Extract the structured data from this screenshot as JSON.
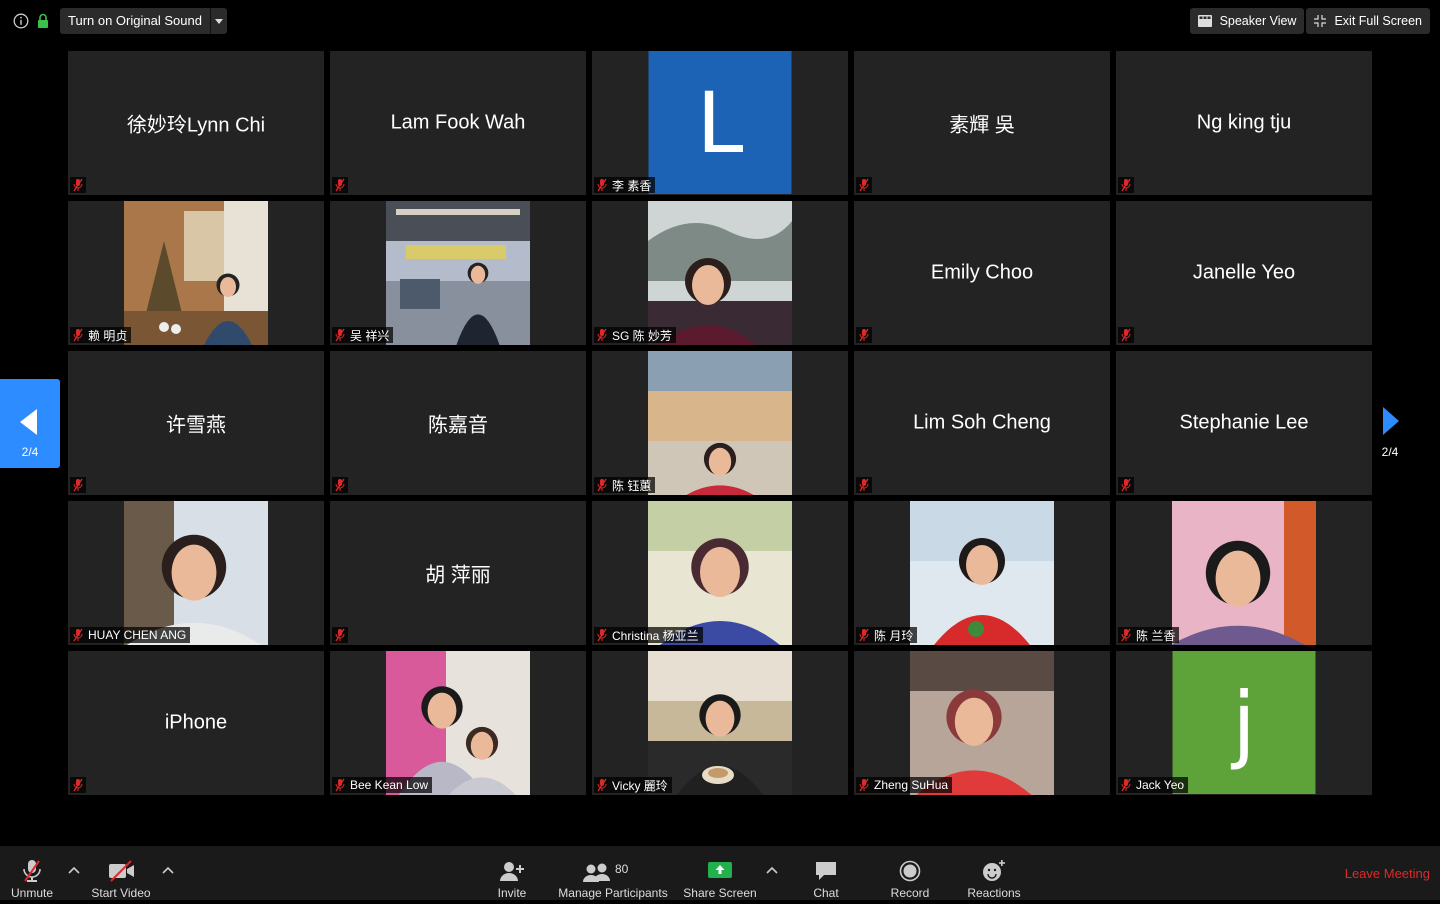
{
  "topbar": {
    "original_sound": "Turn on Original Sound",
    "speaker_view": "Speaker View",
    "exit_full_screen": "Exit Full Screen"
  },
  "pager": {
    "left_page": "2/4",
    "right_page": "2/4"
  },
  "participants": [
    {
      "name": "徐妙玲Lynn Chi",
      "kind": "text"
    },
    {
      "name": "Lam Fook Wah",
      "kind": "text"
    },
    {
      "name": "李 素香",
      "kind": "letter",
      "letter": "L",
      "color": "#1c62b5"
    },
    {
      "name": "素輝 吳",
      "kind": "text"
    },
    {
      "name": "Ng king tju",
      "kind": "text"
    },
    {
      "name": "赖 明贞",
      "kind": "photo",
      "scene": "indoor"
    },
    {
      "name": "吴 祥兴",
      "kind": "photo",
      "scene": "outdoor"
    },
    {
      "name": "SG 陈 妙芳",
      "kind": "photo",
      "scene": "portrait"
    },
    {
      "name": "Emily Choo",
      "kind": "text"
    },
    {
      "name": "Janelle Yeo",
      "kind": "text"
    },
    {
      "name": "许雪燕",
      "kind": "text"
    },
    {
      "name": "陈嘉音",
      "kind": "text"
    },
    {
      "name": "陈 钰蕙",
      "kind": "photo",
      "scene": "mall"
    },
    {
      "name": "Lim Soh Cheng",
      "kind": "text"
    },
    {
      "name": "Stephanie Lee",
      "kind": "text"
    },
    {
      "name": "HUAY CHEN ANG",
      "kind": "photo",
      "scene": "selfie"
    },
    {
      "name": "胡 萍丽",
      "kind": "text"
    },
    {
      "name": "Christina 杨亚兰",
      "kind": "photo",
      "scene": "lady"
    },
    {
      "name": "陈 月玲",
      "kind": "photo",
      "scene": "red"
    },
    {
      "name": "陈 兰香",
      "kind": "photo",
      "scene": "smile"
    },
    {
      "name": "iPhone",
      "kind": "text"
    },
    {
      "name": "Bee Kean Low",
      "kind": "photo",
      "scene": "mother"
    },
    {
      "name": "Vicky 麗玲",
      "kind": "photo",
      "scene": "cafe"
    },
    {
      "name": "Zheng SuHua",
      "kind": "photo",
      "scene": "redhair"
    },
    {
      "name": "Jack Yeo",
      "kind": "letter",
      "letter": "j",
      "color": "#5ea33a"
    }
  ],
  "toolbar": {
    "unmute": "Unmute",
    "start_video": "Start Video",
    "invite": "Invite",
    "participants_count": "80",
    "manage_participants": "Manage Participants",
    "share_screen": "Share Screen",
    "chat": "Chat",
    "record": "Record",
    "reactions": "Reactions",
    "leave": "Leave Meeting"
  },
  "colors": {
    "accent": "#2d8cff",
    "share_green": "#22b14c",
    "leave_red": "#e02828",
    "muted_red": "#e02828"
  }
}
